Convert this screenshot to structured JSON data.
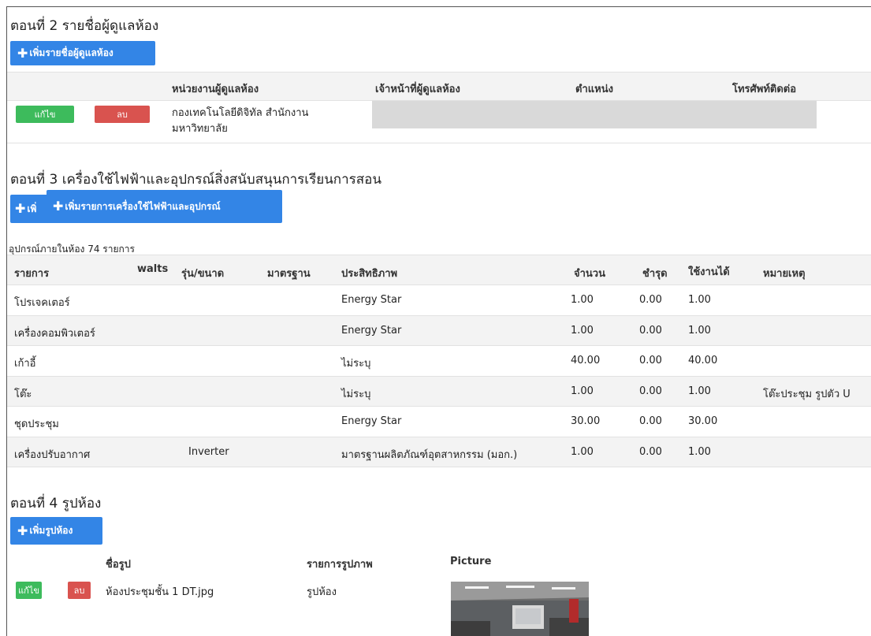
{
  "section2": {
    "title": "ตอนที่ 2 รายชื่อผู้ดูแลห้อง",
    "add_button": "เพิ่มรายชื่อผู้ดูแลห้อง",
    "headers": [
      "หน่วยงานผู้ดูแลห้อง",
      "เจ้าหน้าที่ผู้ดูแลห้อง",
      "ตำแหน่ง",
      "โทรศัพท์ติดต่อ"
    ],
    "row": {
      "edit": "แก้ไข",
      "delete": "ลบ",
      "agency_line1": "กองเทคโนโลยีดิจิทัล สำนักงาน",
      "agency_line2": "มหาวิทยาลัย"
    }
  },
  "section3": {
    "title": "ตอนที่ 3 เครื่องใช้ไฟฟ้าและอุปกรณ์สิ่งสนับสนุนการเรียนการสอน",
    "add_button_clipped": "เพิ่",
    "add_button": "เพิ่มรายการเครื่องใช้ไฟฟ้าและอุปกรณ์",
    "count_text": "อุปกรณ์ภายในห้อง 74 รายการ",
    "headers": {
      "item": "รายการ",
      "walts": "walts",
      "model": "รุ่น/ขนาด",
      "standard": "มาตรฐาน",
      "efficiency": "ประสิทธิภาพ",
      "qty": "จำนวน",
      "broken": "ชำรุด",
      "usable": "ใช้งานได้",
      "note": "หมายเหตุ"
    },
    "rows": [
      {
        "item": "โปรเจคเตอร์",
        "walts": "",
        "model": "",
        "standard": "",
        "efficiency": "Energy Star",
        "qty": "1.00",
        "broken": "0.00",
        "usable": "1.00",
        "note": ""
      },
      {
        "item": "เครื่องคอมพิวเตอร์",
        "walts": "",
        "model": "",
        "standard": "",
        "efficiency": "Energy Star",
        "qty": "1.00",
        "broken": "0.00",
        "usable": "1.00",
        "note": ""
      },
      {
        "item": "เก้าอี้",
        "walts": "",
        "model": "",
        "standard": "",
        "efficiency": "ไม่ระบุ",
        "qty": "40.00",
        "broken": "0.00",
        "usable": "40.00",
        "note": ""
      },
      {
        "item": "โต๊ะ",
        "walts": "",
        "model": "",
        "standard": "",
        "efficiency": "ไม่ระบุ",
        "qty": "1.00",
        "broken": "0.00",
        "usable": "1.00",
        "note": "โต๊ะประชุม รูปตัว U"
      },
      {
        "item": "ชุดประชุม",
        "walts": "",
        "model": "",
        "standard": "",
        "efficiency": "Energy Star",
        "qty": "30.00",
        "broken": "0.00",
        "usable": "30.00",
        "note": ""
      },
      {
        "item": "เครื่องปรับอากาศ",
        "walts": "",
        "model": "Inverter",
        "standard": "",
        "efficiency": "มาตรฐานผลิตภัณฑ์อุตสาหกรรม (มอก.)",
        "qty": "1.00",
        "broken": "0.00",
        "usable": "1.00",
        "note": ""
      }
    ]
  },
  "section4": {
    "title": "ตอนที่ 4 รูปห้อง",
    "add_button": "เพิ่มรูปห้อง",
    "headers": [
      "ชื่อรูป",
      "รายการรูปภาพ",
      "Picture"
    ],
    "row": {
      "edit": "แก้ไข",
      "delete": "ลบ",
      "name": "ห้องประชุมชั้น 1 DT.jpg",
      "category": "รูปห้อง"
    }
  },
  "colors": {
    "primary": "#3385e6",
    "success": "#3dbb5c",
    "danger": "#d9534f"
  }
}
